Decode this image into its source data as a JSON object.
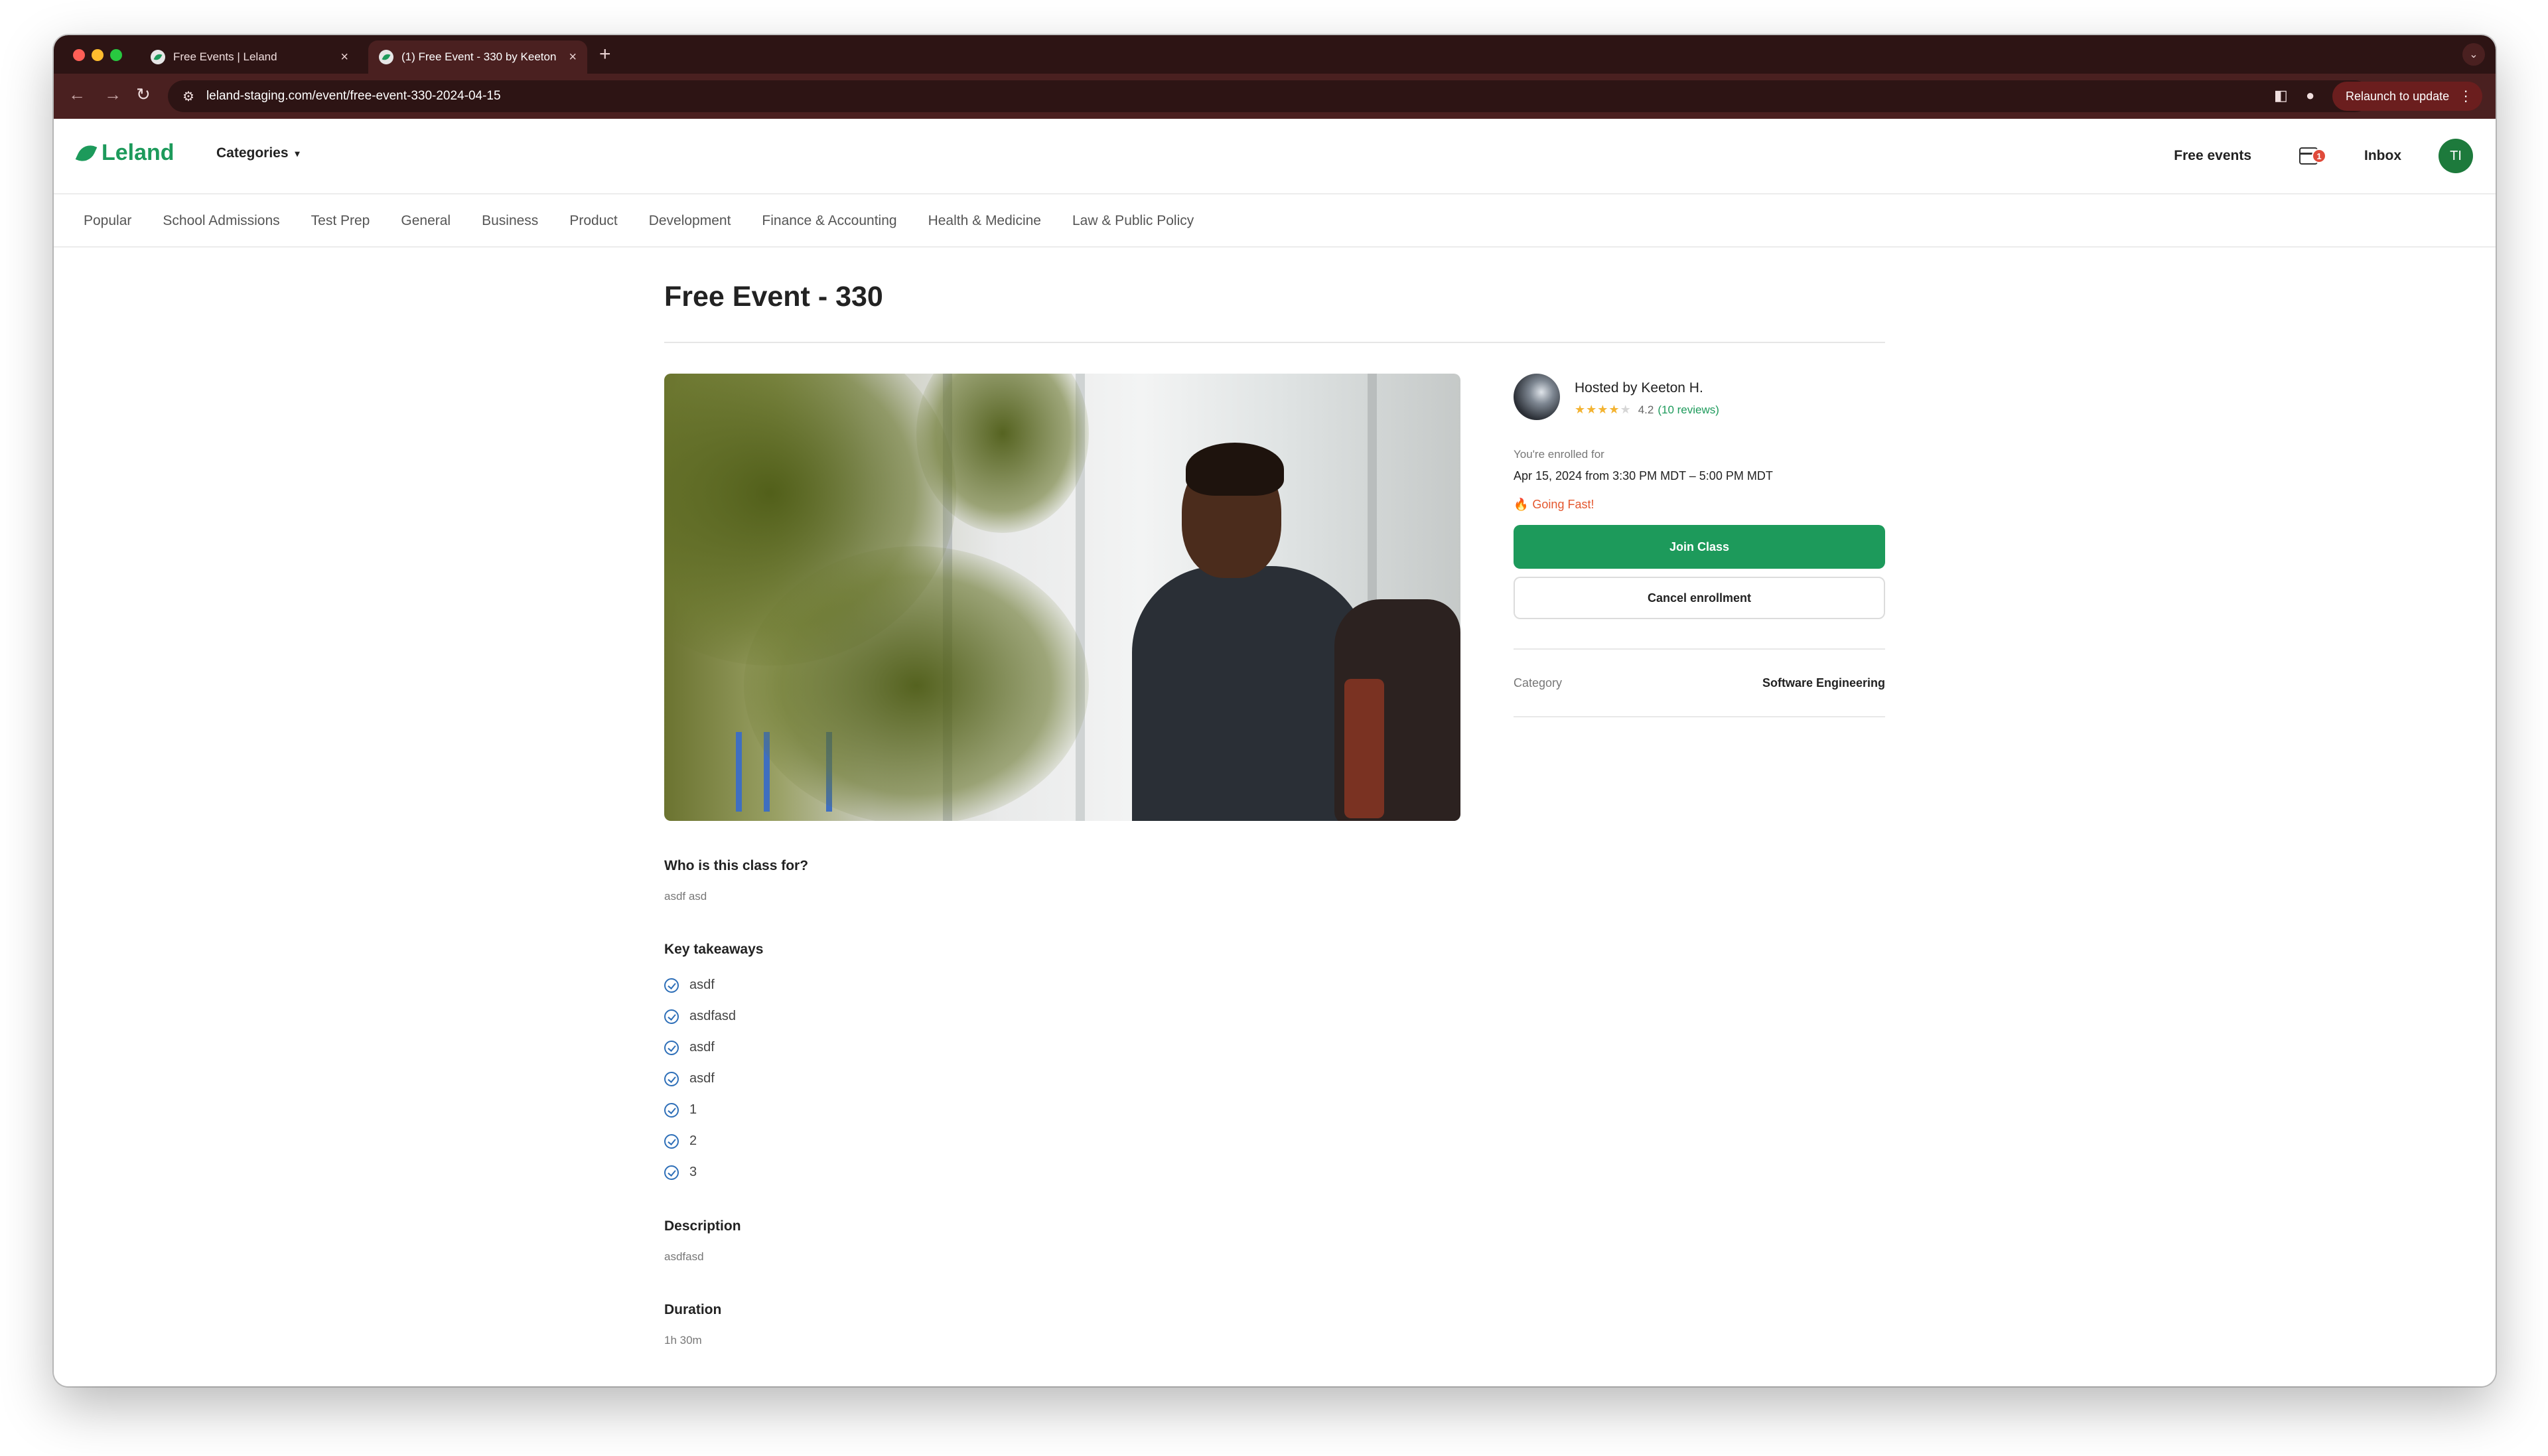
{
  "browser": {
    "tabs": [
      {
        "title": "Free Events | Leland",
        "active": false
      },
      {
        "title": "(1) Free Event - 330 by Keeton",
        "active": true
      }
    ],
    "url": "leland-staging.com/event/free-event-330-2024-04-15",
    "relaunch_label": "Relaunch to update"
  },
  "header": {
    "logo": "Leland",
    "categories_label": "Categories",
    "free_events_label": "Free events",
    "calendar_badge": "1",
    "inbox_label": "Inbox",
    "user_initials": "TI"
  },
  "catnav": [
    "Popular",
    "School Admissions",
    "Test Prep",
    "General",
    "Business",
    "Product",
    "Development",
    "Finance & Accounting",
    "Health & Medicine",
    "Law & Public Policy"
  ],
  "event": {
    "title": "Free Event - 330",
    "host": "Hosted by Keeton H.",
    "rating": 4.2,
    "rating_text": "4.2",
    "reviews": "(10 reviews)",
    "enrolled_label": "You're enrolled for",
    "enrolled_time": "Apr 15, 2024 from 3:30 PM MDT – 5:00 PM MDT",
    "going_fast": "Going Fast!",
    "join_label": "Join Class",
    "cancel_label": "Cancel enrollment",
    "category_label": "Category",
    "category_value": "Software Engineering"
  },
  "details": {
    "who_title": "Who is this class for?",
    "who_text": "asdf asd",
    "takeaways_title": "Key takeaways",
    "takeaways": [
      "asdf",
      "asdfasd",
      "asdf",
      "asdf",
      "1",
      "2",
      "3"
    ],
    "description_title": "Description",
    "description_text": "asdfasd",
    "duration_title": "Duration",
    "duration_text": "1h 30m"
  },
  "colors": {
    "brand_green": "#1d9a5b",
    "chrome_dark": "#2d1414",
    "chrome_toolbar": "#4a2020",
    "going_fast": "#e4572e",
    "check_blue": "#2e6fb8"
  }
}
